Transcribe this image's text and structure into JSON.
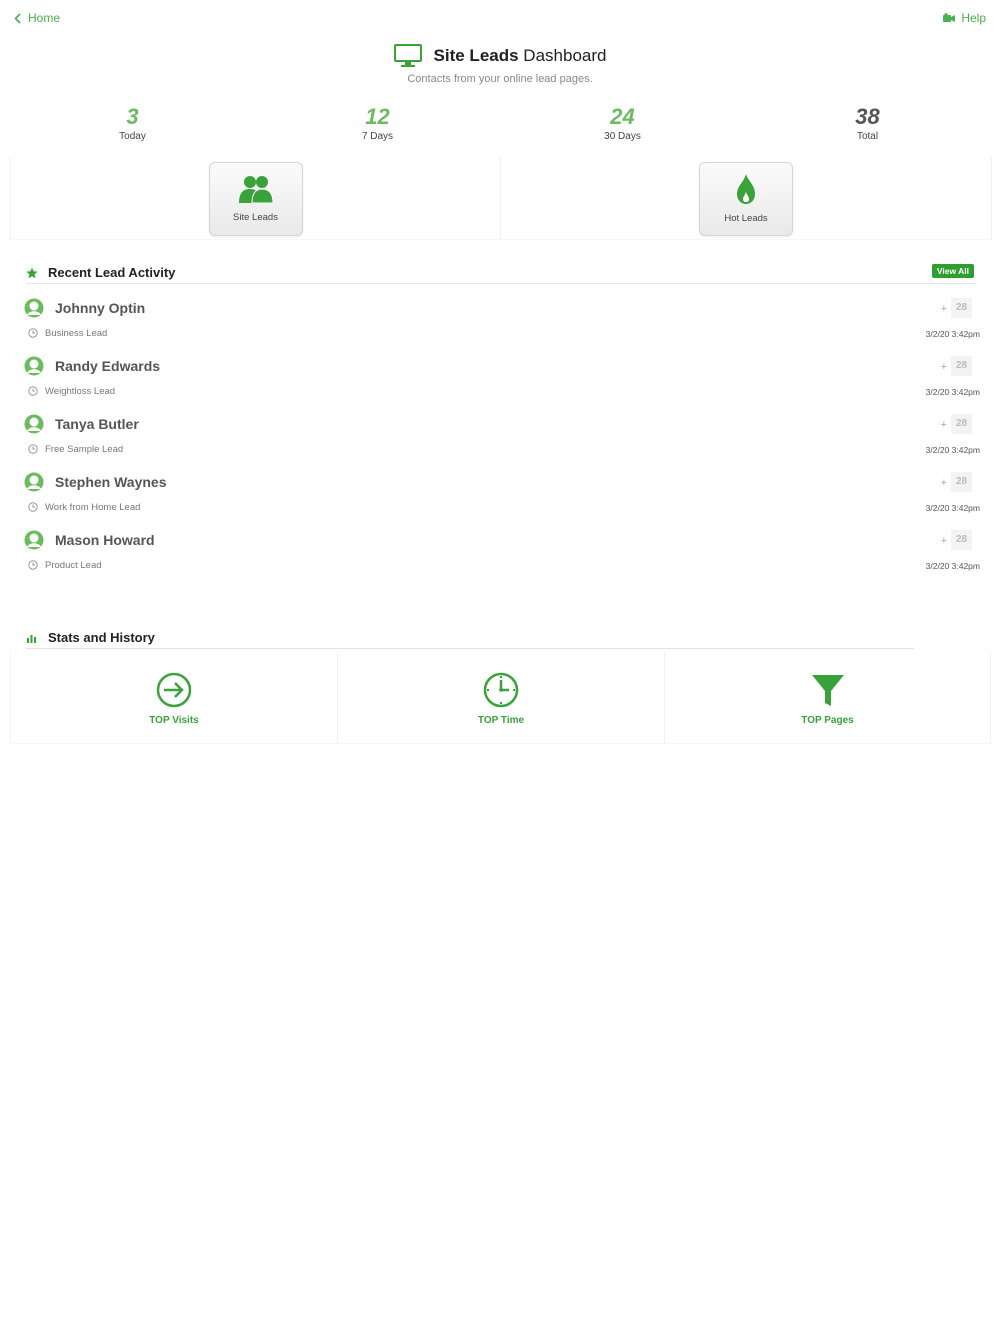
{
  "nav": {
    "back_label": "Home",
    "help_label": "Help"
  },
  "header": {
    "title_bold": "Site Leads",
    "title_rest": " Dashboard",
    "subtitle": "Contacts from your online lead pages."
  },
  "stats": [
    {
      "value": "3",
      "label": "Today"
    },
    {
      "value": "12",
      "label": "7 Days"
    },
    {
      "value": "24",
      "label": "30 Days"
    },
    {
      "value": "38",
      "label": "Total"
    }
  ],
  "quick_buttons": [
    {
      "label": "Site Leads",
      "icon": "users-icon"
    },
    {
      "label": "Hot Leads",
      "icon": "flame-icon"
    }
  ],
  "recent": {
    "title": "Recent Lead Activity",
    "view_all_label": "View All",
    "leads": [
      {
        "name": "Johnny Optin",
        "type": "Business Lead",
        "plus": "+",
        "count": "28",
        "date": "3/2/20 3:42pm"
      },
      {
        "name": "Randy Edwards",
        "type": "Weightloss Lead",
        "plus": "+",
        "count": "28",
        "date": "3/2/20 3:42pm"
      },
      {
        "name": "Tanya Butler",
        "type": "Free Sample Lead",
        "plus": "+",
        "count": "28",
        "date": "3/2/20 3:42pm"
      },
      {
        "name": "Stephen Waynes",
        "type": "Work from Home Lead",
        "plus": "+",
        "count": "28",
        "date": "3/2/20 3:42pm"
      },
      {
        "name": "Mason Howard",
        "type": "Product Lead",
        "plus": "+",
        "count": "28",
        "date": "3/2/20 3:42pm"
      }
    ]
  },
  "stats_history": {
    "title": "Stats and History",
    "tools": [
      {
        "label": "TOP Visits",
        "icon": "sign-in-icon"
      },
      {
        "label": "TOP Time",
        "icon": "clock-icon"
      },
      {
        "label": "TOP Pages",
        "icon": "funnel-icon"
      }
    ]
  },
  "colors": {
    "accent": "#3aa23a",
    "stat_green": "#6dbb5f",
    "badge": "#2e9e2e"
  }
}
